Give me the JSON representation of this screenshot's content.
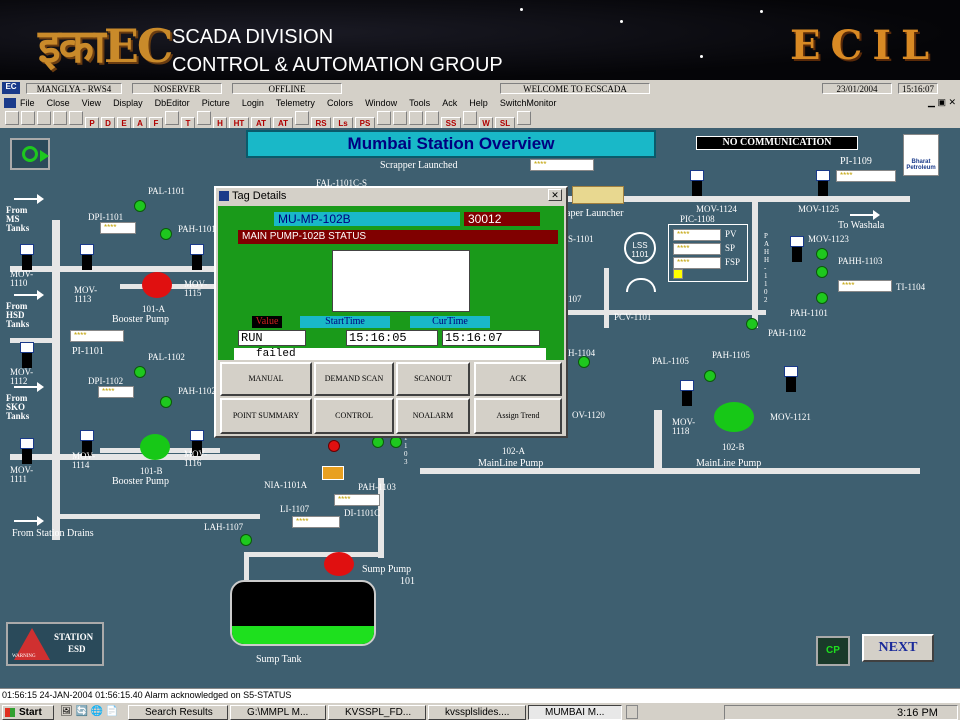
{
  "banner": {
    "logo_left": "इकाEC",
    "line1": "SCADA DIVISION",
    "line2": "CONTROL & AUTOMATION GROUP",
    "logo_right": "ECIL"
  },
  "statusbar": {
    "station": "MANGLYA - RWS4",
    "server": "NOSERVER",
    "mode": "OFFLINE",
    "welcome": "WELCOME TO ECSCADA",
    "date": "23/01/2004",
    "time": "15:16:07"
  },
  "menu": [
    "File",
    "Close",
    "View",
    "Display",
    "DbEditor",
    "Picture",
    "Login",
    "Telemetry",
    "Colors",
    "Window",
    "Tools",
    "Ack",
    "Help",
    "SwitchMonitor"
  ],
  "toolbar": [
    "",
    "",
    "",
    "",
    "",
    "P",
    "D",
    "E",
    "A",
    "F",
    "",
    "T",
    "",
    "H",
    "HT",
    "AT",
    "AT",
    "",
    "RS",
    "Ls",
    "PS",
    "",
    "",
    "",
    "",
    "SS",
    "",
    "W",
    "SL",
    ""
  ],
  "screen": {
    "title": "Mumbai Station Overview",
    "no_comm": "NO COMMUNICATION",
    "scrapper": "Scrapper Launched",
    "scrapper_launcher": "aper Launcher",
    "stars": "****",
    "to_washala": "To Washala",
    "from_ms": "From\nMS\nTanks",
    "from_hsd": "From\nHSD\nTanks",
    "from_sko": "From\nSKO\nTanks",
    "from_drains": "From Station Drains",
    "booster_a": "Booster Pump",
    "booster_b": "Booster Pump",
    "mainline_a": "MainLine Pump",
    "mainline_b": "MainLine Pump",
    "sump_pump": "Sump Pump",
    "sump_pump_no": "101",
    "sump_tank": "Sump Tank",
    "pump_101a": "101-A",
    "pump_101b": "101-B",
    "pump_102a": "102-A",
    "pump_102b": "102-B",
    "tags": {
      "pal1101": "PAL-1101",
      "dpi1101": "DPI-1101",
      "pah1101": "PAH-1101",
      "mov1110": "MOV-\n1110",
      "mov1113": "MOV-\n1113",
      "mov1115": "MOV-\n1115",
      "pi1101": "PI-1101",
      "pal1102": "PAL-1102",
      "dpi1102": "DPI-1102",
      "pah1102": "PAH-1102",
      "mov1112": "MOV-\n1112",
      "mov1114": "MOV-\n1114",
      "mov1116": "MOV-\n1116",
      "mov1111": "MOV-\n1111",
      "fal": "FAL-1101C-S",
      "mov1124": "MOV-1124",
      "mov1125": "MOV-1125",
      "pi1109": "PI-1109",
      "pic1108": "PIC-1108",
      "mov1123": "MOV-1123",
      "pahh1103": "PAHH-1103",
      "ti1104": "TI-1104",
      "pah1101b": "PAH-1101",
      "pah1102b": "PAH-1102",
      "pcv1101": "PCV-1101",
      "lss": "LSS\n1101",
      "pv": "PV",
      "sp": "SP",
      "fsp": "FSP",
      "s1101": "S-1101",
      "n107": "107",
      "h1104": "H-1104",
      "pal1105": "PAL-1105",
      "pah1105": "PAH-1105",
      "mov1120": "OV-1120",
      "mov1118": "MOV-\n1118",
      "mov1121": "MOV-1121",
      "nia": "NIA-1101A",
      "pah1103": "PAH-1103",
      "di1101c": "DI-1101C",
      "li1107": "LI-1107",
      "lah1107": "LAH-1107",
      "vert1103": "1\n1\n0\n3",
      "vert_pahh": "P\nA\nH\nH\n-\n1\n1\n0\n2"
    },
    "next": "NEXT",
    "station_esd": "STATION",
    "esd": "ESD",
    "warning": "WARNING",
    "bharat": "Bharat\nPetroleum",
    "cp": "CP"
  },
  "dialog": {
    "title": "Tag Details",
    "tag": "MU-MP-102B",
    "tag_no": "30012",
    "desc": "MAIN PUMP-102B STATUS",
    "value_label": "Value",
    "start_label": "StartTime",
    "cur_label": "CurTime",
    "value": "RUN",
    "start": "15:16:05",
    "cur": "15:16:07",
    "status": "failed",
    "buttons": [
      "MANUAL",
      "DEMAND SCAN",
      "SCANOUT",
      "ACK",
      "POINT SUMMARY",
      "CONTROL",
      "NOALARM",
      "Assign Trend"
    ]
  },
  "alarm_line": "01:56:15 24-JAN-2004 01:56:15.40 Alarm acknowledged on S5-STATUS",
  "taskbar": {
    "start": "Start",
    "items": [
      "Search Results",
      "G:\\MMPL M...",
      "KVSSPL_FD...",
      "kvssplslides....",
      "MUMBAI M..."
    ],
    "clock": "3:16 PM"
  },
  "colors": {
    "canvas": "#3e5f70",
    "title_bg": "#19b8c8",
    "title_text": "#000080",
    "dialog_green": "#1a9a1a"
  }
}
